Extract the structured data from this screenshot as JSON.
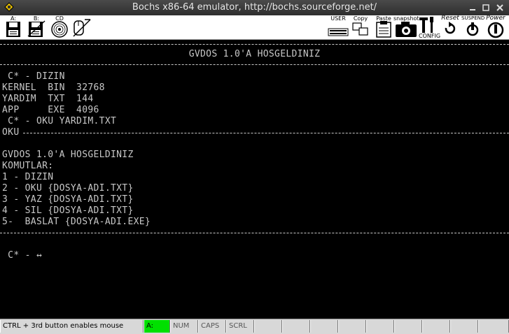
{
  "window": {
    "title": "Bochs x86-64 emulator, http://bochs.sourceforge.net/"
  },
  "toolbar": {
    "drive_a": "A:",
    "drive_b": "B:",
    "cdrom": "CD",
    "user": "USER",
    "copy": "Copy",
    "paste": "Paste",
    "snapshot": "snapshot",
    "config": "CONFIG",
    "reset": "Reset",
    "suspend": "SUSPEND",
    "power": "Power"
  },
  "console": {
    "banner": "GVDOS 1.0'A HOSGELDINIZ",
    "cmd1": " C* - DIZIN",
    "dir_rows": [
      "KERNEL  BIN  32768",
      "YARDIM  TXT  144",
      "APP     EXE  4096"
    ],
    "cmd2": " C* - OKU YARDIM.TXT",
    "oku": "OKU",
    "help_lines": [
      "GVDOS 1.0'A HOSGELDINIZ",
      "KOMUTLAR:",
      "1 - DIZIN",
      "2 - OKU {DOSYA-ADI.TXT}",
      "3 - YAZ {DOSYA-ADI.TXT}",
      "4 - SIL {DOSYA-ADI.TXT}",
      "5-  BASLAT {DOSYA-ADI.EXE}"
    ],
    "prompt": " C* - ↔"
  },
  "statusbar": {
    "hint": "CTRL + 3rd button enables mouse",
    "a": "A:",
    "num": "NUM",
    "caps": "CAPS",
    "scrl": "SCRL"
  },
  "colors": {
    "led_active": "#00e000",
    "screen_text": "#c8c8c8",
    "background": "#000000"
  }
}
